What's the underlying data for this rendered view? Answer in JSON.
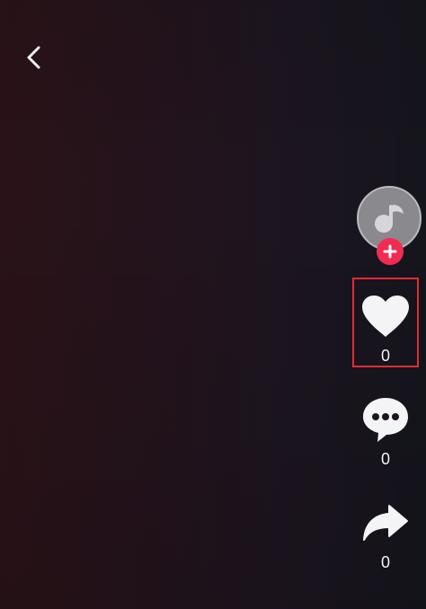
{
  "rail": {
    "likes": {
      "count": "0"
    },
    "comments": {
      "count": "0"
    },
    "shares": {
      "count": "0"
    }
  },
  "icons": {
    "back": "chevron-left-icon",
    "avatar": "music-note-avatar-icon",
    "follow": "plus-icon",
    "like": "heart-icon",
    "comment": "chat-bubble-icon",
    "share": "share-arrow-icon"
  },
  "colors": {
    "background_left": "#2a1318",
    "background_right": "#15151d",
    "follow_badge": "#f22b52",
    "highlight_border": "#e12b35",
    "icon_light": "#f4f4f6",
    "avatar_gray": "#8a8a8e"
  }
}
